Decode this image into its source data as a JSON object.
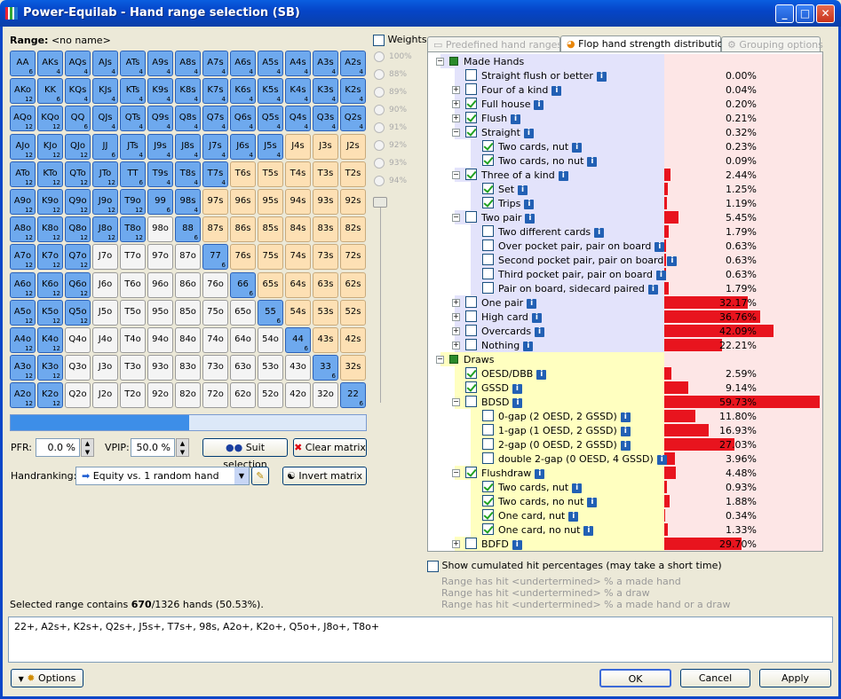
{
  "window": {
    "title": "Power-Equilab - Hand range selection (SB)",
    "min": "_",
    "max": "□",
    "close": "✕"
  },
  "range": {
    "label": "Range:",
    "name": "<no name>"
  },
  "matrix": [
    [
      "AA|6|s",
      "AKs|4|s",
      "AQs|4|s",
      "AJs|4|s",
      "ATs|4|s",
      "A9s|4|s",
      "A8s|4|s",
      "A7s|4|s",
      "A6s|4|s",
      "A5s|4|s",
      "A4s|4|s",
      "A3s|4|s",
      "A2s|4|s"
    ],
    [
      "AKo|12|s",
      "KK|6|s",
      "KQs|4|s",
      "KJs|4|s",
      "KTs|4|s",
      "K9s|4|s",
      "K8s|4|s",
      "K7s|4|s",
      "K6s|4|s",
      "K5s|4|s",
      "K4s|4|s",
      "K3s|4|s",
      "K2s|4|s"
    ],
    [
      "AQo|12|s",
      "KQo|12|s",
      "QQ|6|s",
      "QJs|4|s",
      "QTs|4|s",
      "Q9s|4|s",
      "Q8s|4|s",
      "Q7s|4|s",
      "Q6s|4|s",
      "Q5s|4|s",
      "Q4s|4|s",
      "Q3s|4|s",
      "Q2s|4|s"
    ],
    [
      "AJo|12|s",
      "KJo|12|s",
      "QJo|12|s",
      "JJ|6|s",
      "JTs|4|s",
      "J9s|4|s",
      "J8s|4|s",
      "J7s|4|s",
      "J6s|4|s",
      "J5s|4|s",
      "J4s||t",
      "J3s||t",
      "J2s||t"
    ],
    [
      "ATo|12|s",
      "KTo|12|s",
      "QTo|12|s",
      "JTo|12|s",
      "TT|6|s",
      "T9s|4|s",
      "T8s|4|s",
      "T7s|4|s",
      "T6s||t",
      "T5s||t",
      "T4s||t",
      "T3s||t",
      "T2s||t"
    ],
    [
      "A9o|12|s",
      "K9o|12|s",
      "Q9o|12|s",
      "J9o|12|s",
      "T9o|12|s",
      "99|6|s",
      "98s|4|s",
      "97s||t",
      "96s||t",
      "95s||t",
      "94s||t",
      "93s||t",
      "92s||t"
    ],
    [
      "A8o|12|s",
      "K8o|12|s",
      "Q8o|12|s",
      "J8o|12|s",
      "T8o|12|s",
      "98o||u",
      "88|6|s",
      "87s||t",
      "86s||t",
      "85s||t",
      "84s||t",
      "83s||t",
      "82s||t"
    ],
    [
      "A7o|12|s",
      "K7o|12|s",
      "Q7o|12|s",
      "J7o||u",
      "T7o||u",
      "97o||u",
      "87o||u",
      "77|6|s",
      "76s||t",
      "75s||t",
      "74s||t",
      "73s||t",
      "72s||t"
    ],
    [
      "A6o|12|s",
      "K6o|12|s",
      "Q6o|12|s",
      "J6o||u",
      "T6o||u",
      "96o||u",
      "86o||u",
      "76o||u",
      "66|6|s",
      "65s||t",
      "64s||t",
      "63s||t",
      "62s||t"
    ],
    [
      "A5o|12|s",
      "K5o|12|s",
      "Q5o|12|s",
      "J5o||u",
      "T5o||u",
      "95o||u",
      "85o||u",
      "75o||u",
      "65o||u",
      "55|6|s",
      "54s||t",
      "53s||t",
      "52s||t"
    ],
    [
      "A4o|12|s",
      "K4o|12|s",
      "Q4o||u",
      "J4o||u",
      "T4o||u",
      "94o||u",
      "84o||u",
      "74o||u",
      "64o||u",
      "54o||u",
      "44|6|s",
      "43s||t",
      "42s||t"
    ],
    [
      "A3o|12|s",
      "K3o|12|s",
      "Q3o||u",
      "J3o||u",
      "T3o||u",
      "93o||u",
      "83o||u",
      "73o||u",
      "63o||u",
      "53o||u",
      "43o||u",
      "33|6|s",
      "32s||t"
    ],
    [
      "A2o|12|s",
      "K2o|12|s",
      "Q2o||u",
      "J2o||u",
      "T2o||u",
      "92o||u",
      "82o||u",
      "72o||u",
      "62o||u",
      "52o||u",
      "42o||u",
      "32o||u",
      "22|6|s"
    ]
  ],
  "weights": {
    "label": "Weights",
    "levels": [
      "100%",
      "88%",
      "89%",
      "90%",
      "91%",
      "92%",
      "93%",
      "94%"
    ]
  },
  "slider": {
    "fill_fraction": 0.505
  },
  "pfr": {
    "label": "PFR:",
    "value": "0.0 %"
  },
  "vpip": {
    "label": "VPIP:",
    "value": "50.0 %"
  },
  "buttons": {
    "suit_selection": "Suit selection",
    "clear_matrix": "Clear matrix",
    "invert_matrix": "Invert matrix",
    "options": "Options",
    "ok": "OK",
    "cancel": "Cancel",
    "apply": "Apply"
  },
  "handranking": {
    "label": "Handranking:",
    "value": "Equity vs. 1 random hand"
  },
  "tabs": [
    "Predefined hand ranges",
    "Flop hand strength distribution",
    "Grouping options"
  ],
  "tree": [
    {
      "label": "Made Hands",
      "pct": "",
      "bar": 0,
      "level": 0,
      "group": "made",
      "expander": "−",
      "check": "group"
    },
    {
      "label": "Straight flush or better",
      "pct": "0.00%",
      "bar": 0,
      "level": 1,
      "group": "made",
      "check": "off"
    },
    {
      "label": "Four of a kind",
      "pct": "0.04%",
      "bar": 0,
      "level": 1,
      "group": "made",
      "expander": "+",
      "check": "off"
    },
    {
      "label": "Full house",
      "pct": "0.20%",
      "bar": 0,
      "level": 1,
      "group": "made",
      "expander": "+",
      "check": "on"
    },
    {
      "label": "Flush",
      "pct": "0.21%",
      "bar": 0,
      "level": 1,
      "group": "made",
      "expander": "+",
      "check": "on"
    },
    {
      "label": "Straight",
      "pct": "0.32%",
      "bar": 0,
      "level": 1,
      "group": "made",
      "expander": "−",
      "check": "on"
    },
    {
      "label": "Two cards, nut",
      "pct": "0.23%",
      "bar": 0,
      "level": 2,
      "group": "made",
      "check": "on"
    },
    {
      "label": "Two cards, no nut",
      "pct": "0.09%",
      "bar": 0,
      "level": 2,
      "group": "made",
      "check": "on"
    },
    {
      "label": "Three of a kind",
      "pct": "2.44%",
      "bar": 2.44,
      "level": 1,
      "group": "made",
      "expander": "−",
      "check": "on"
    },
    {
      "label": "Set",
      "pct": "1.25%",
      "bar": 1.25,
      "level": 2,
      "group": "made",
      "check": "on"
    },
    {
      "label": "Trips",
      "pct": "1.19%",
      "bar": 1.19,
      "level": 2,
      "group": "made",
      "check": "on"
    },
    {
      "label": "Two pair",
      "pct": "5.45%",
      "bar": 5.45,
      "level": 1,
      "group": "made",
      "expander": "−",
      "check": "off"
    },
    {
      "label": "Two different cards",
      "pct": "1.79%",
      "bar": 1.79,
      "level": 2,
      "group": "made",
      "check": "off"
    },
    {
      "label": "Over pocket pair, pair on board",
      "pct": "0.63%",
      "bar": 0.63,
      "level": 2,
      "group": "made",
      "check": "off"
    },
    {
      "label": "Second pocket pair, pair on board",
      "pct": "0.63%",
      "bar": 0.63,
      "level": 2,
      "group": "made",
      "check": "off"
    },
    {
      "label": "Third pocket pair, pair on board",
      "pct": "0.63%",
      "bar": 0.63,
      "level": 2,
      "group": "made",
      "check": "off"
    },
    {
      "label": "Pair on board, sidecard paired",
      "pct": "1.79%",
      "bar": 1.79,
      "level": 2,
      "group": "made",
      "check": "off"
    },
    {
      "label": "One pair",
      "pct": "32.17%",
      "bar": 32.17,
      "level": 1,
      "group": "made",
      "expander": "+",
      "check": "off"
    },
    {
      "label": "High card",
      "pct": "36.76%",
      "bar": 36.76,
      "level": 1,
      "group": "made",
      "expander": "+",
      "check": "off"
    },
    {
      "label": "Overcards",
      "pct": "42.09%",
      "bar": 42.09,
      "level": 1,
      "group": "made",
      "expander": "+",
      "check": "off"
    },
    {
      "label": "Nothing",
      "pct": "22.21%",
      "bar": 22.21,
      "level": 1,
      "group": "made",
      "expander": "+",
      "check": "off"
    },
    {
      "label": "Draws",
      "pct": "",
      "bar": 0,
      "level": 0,
      "group": "draw",
      "expander": "−",
      "check": "group"
    },
    {
      "label": "OESD/DBB",
      "pct": "2.59%",
      "bar": 2.59,
      "level": 1,
      "group": "draw",
      "check": "on"
    },
    {
      "label": "GSSD",
      "pct": "9.14%",
      "bar": 9.14,
      "level": 1,
      "group": "draw",
      "check": "on"
    },
    {
      "label": "BDSD",
      "pct": "59.73%",
      "bar": 59.73,
      "level": 1,
      "group": "draw",
      "expander": "−",
      "check": "off"
    },
    {
      "label": "0-gap (2 OESD, 2 GSSD)",
      "pct": "11.80%",
      "bar": 11.8,
      "level": 2,
      "group": "draw",
      "check": "off"
    },
    {
      "label": "1-gap (1 OESD, 2 GSSD)",
      "pct": "16.93%",
      "bar": 16.93,
      "level": 2,
      "group": "draw",
      "check": "off"
    },
    {
      "label": "2-gap (0 OESD, 2 GSSD)",
      "pct": "27.03%",
      "bar": 27.03,
      "level": 2,
      "group": "draw",
      "check": "off"
    },
    {
      "label": "double 2-gap (0 OESD, 4 GSSD)",
      "pct": "3.96%",
      "bar": 3.96,
      "level": 2,
      "group": "draw",
      "check": "off"
    },
    {
      "label": "Flushdraw",
      "pct": "4.48%",
      "bar": 4.48,
      "level": 1,
      "group": "draw",
      "expander": "−",
      "check": "on"
    },
    {
      "label": "Two cards, nut",
      "pct": "0.93%",
      "bar": 0.93,
      "level": 2,
      "group": "draw",
      "check": "on"
    },
    {
      "label": "Two cards, no nut",
      "pct": "1.88%",
      "bar": 1.88,
      "level": 2,
      "group": "draw",
      "check": "on"
    },
    {
      "label": "One card, nut",
      "pct": "0.34%",
      "bar": 0.34,
      "level": 2,
      "group": "draw",
      "check": "on"
    },
    {
      "label": "One card, no nut",
      "pct": "1.33%",
      "bar": 1.33,
      "level": 2,
      "group": "draw",
      "check": "on"
    },
    {
      "label": "BDFD",
      "pct": "29.70%",
      "bar": 29.7,
      "level": 1,
      "group": "draw",
      "expander": "+",
      "check": "off"
    }
  ],
  "cumulated": {
    "label": "Show cumulated hit percentages (may take a short time)",
    "lines": [
      "Range has hit <undertermined> % a made hand",
      "Range has hit <undertermined> % a draw",
      "Range has hit <undertermined> % a made hand or a draw"
    ]
  },
  "selected": {
    "prefix": "Selected range contains ",
    "count": "670",
    "suffix": "/1326 hands (50.53%)."
  },
  "range_text": "22+, A2s+, K2s+, Q2s+, J5s+, T7s+, 98s, A2o+, K2o+, Q5o+, J8o+, T8o+",
  "colors": {
    "selected": "#6ea9ee",
    "tan": "#fde0b4",
    "made_bg": "#e3e3fb",
    "draw_bg": "#ffffc0",
    "pct_bg": "#fde6e6",
    "bar": "#e8141e"
  }
}
